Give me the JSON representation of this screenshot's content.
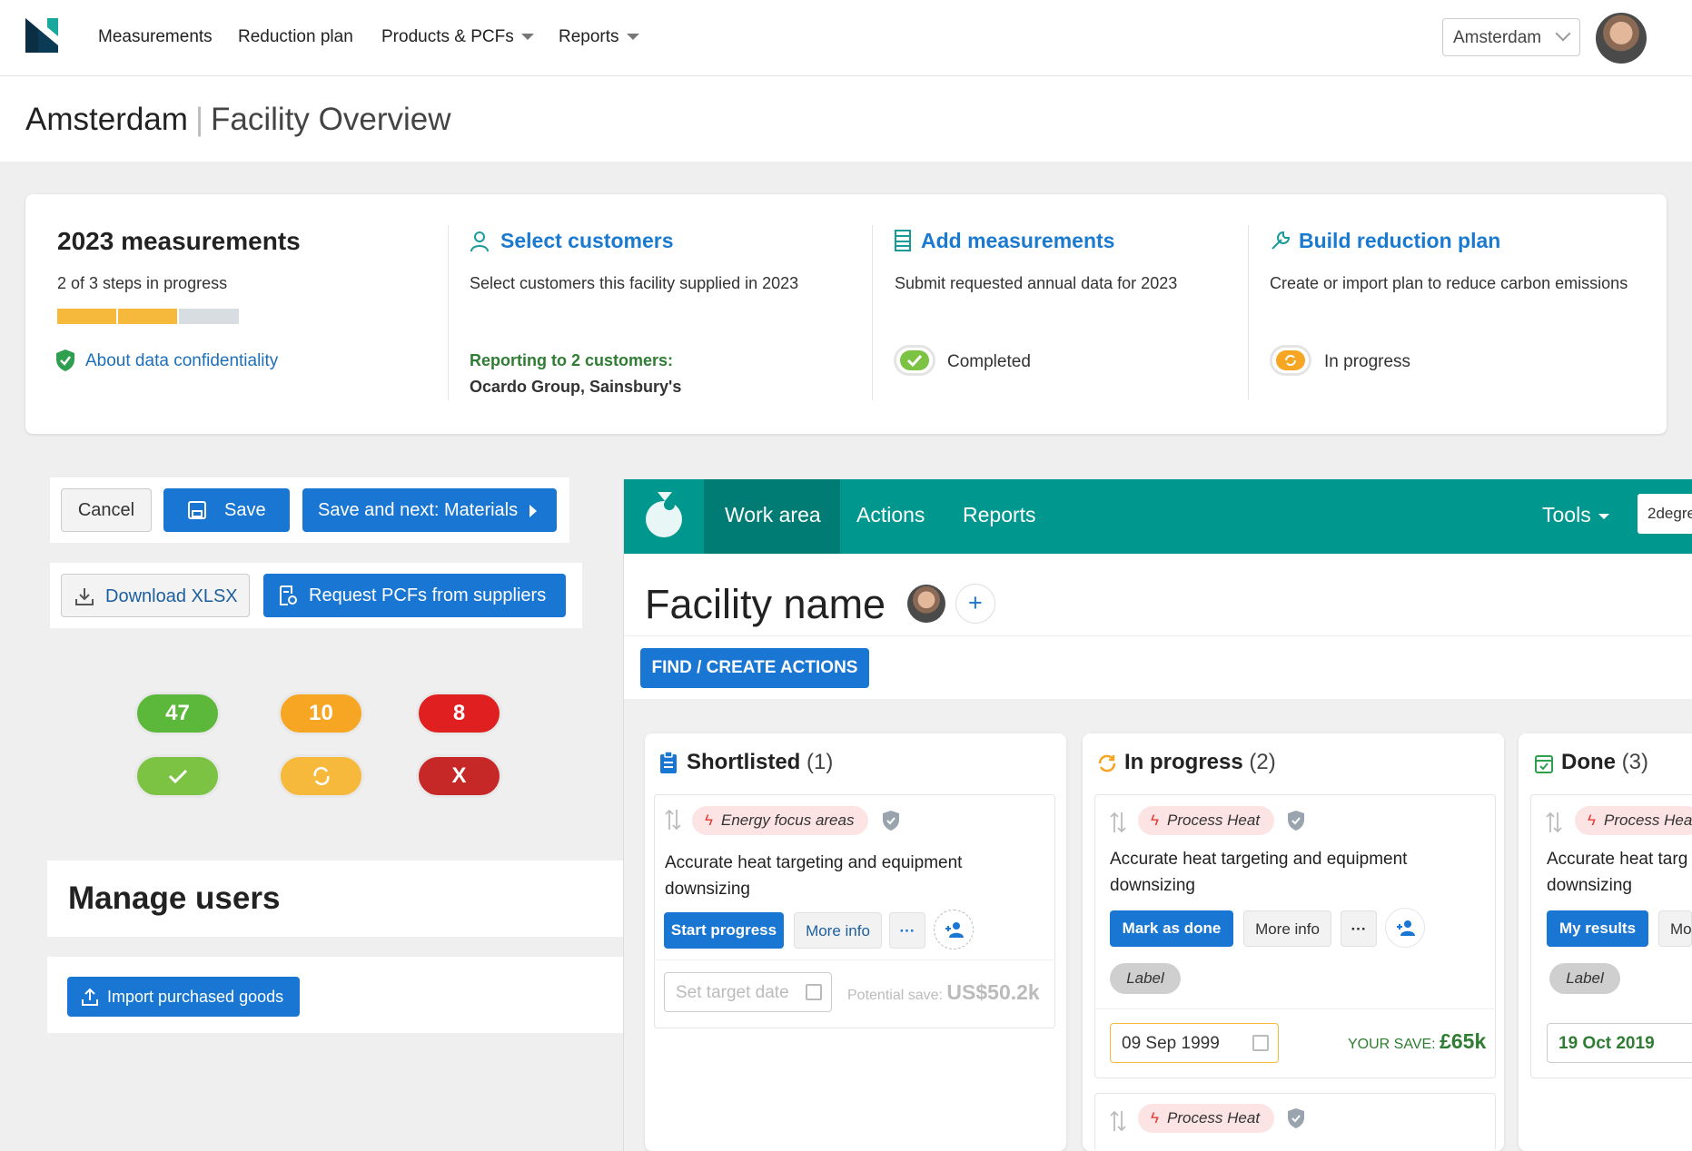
{
  "nav": {
    "items": [
      {
        "label": "Measurements"
      },
      {
        "label": "Reduction plan"
      },
      {
        "label": "Products & PCFs"
      },
      {
        "label": "Reports"
      }
    ],
    "city_select": "Amsterdam"
  },
  "page": {
    "title": "Amsterdam",
    "subtitle": "Facility Overview"
  },
  "overview": {
    "heading": "2023 measurements",
    "progress_text": "2 of 3 steps in progress",
    "progress": {
      "done_steps": 2,
      "total_steps": 3
    },
    "confidentiality_link": "About data confidentiality",
    "steps": [
      {
        "title": "Select customers",
        "desc": "Select customers this facility supplied in 2023",
        "reporting_label": "Reporting to 2 customers:",
        "reporting_value": "Ocardo Group, Sainsbury's"
      },
      {
        "title": "Add measurements",
        "desc": "Submit requested annual data for 2023",
        "status": "Completed"
      },
      {
        "title": "Build reduction plan",
        "desc": "Create or import plan to reduce carbon emissions",
        "status": "In progress"
      }
    ]
  },
  "actions": {
    "cancel": "Cancel",
    "save": "Save",
    "save_next": "Save and next: Materials",
    "download": "Download XLSX",
    "request": "Request PCFs from suppliers"
  },
  "counters": {
    "green": "47",
    "orange": "10",
    "red": "8",
    "red_symbol": "X"
  },
  "manage_users": {
    "title": "Manage users",
    "import_button": "Import purchased goods"
  },
  "app": {
    "tabs": [
      "Work area",
      "Actions",
      "Reports"
    ],
    "tools": "Tools",
    "search_value": "2degre",
    "facility_name": "Facility name",
    "find_create": "FIND / CREATE ACTIONS",
    "columns": [
      {
        "name": "Shortlisted",
        "count": "(1)",
        "items": [
          {
            "tag": "Energy focus areas",
            "text": "Accurate heat targeting and equipment downsizing",
            "primary": "Start progress",
            "secondary": "More info",
            "date_placeholder": "Set target date",
            "save_label": "Potential save:",
            "save_value": "US$50.2k"
          }
        ]
      },
      {
        "name": "In progress",
        "count": "(2)",
        "items": [
          {
            "tag": "Process Heat",
            "text": "Accurate heat targeting and equipment downsizing",
            "primary": "Mark as done",
            "secondary": "More info",
            "label": "Label",
            "date": "09 Sep 1999",
            "save_label": "YOUR SAVE:",
            "save_value": "£65k"
          },
          {
            "tag": "Process Heat"
          }
        ]
      },
      {
        "name": "Done",
        "count": "(3)",
        "items": [
          {
            "tag": "Process Hea",
            "text": "Accurate heat targ",
            "text2": "downsizing",
            "primary": "My results",
            "secondary": "Mo",
            "label": "Label",
            "date": "19 Oct 2019"
          }
        ]
      }
    ],
    "more_dots": "···"
  },
  "colors": {
    "brand_blue": "#1976d2",
    "teal": "#00978f",
    "progress_orange": "#f6b93b",
    "green": "#7cc243",
    "red": "#e53935"
  }
}
